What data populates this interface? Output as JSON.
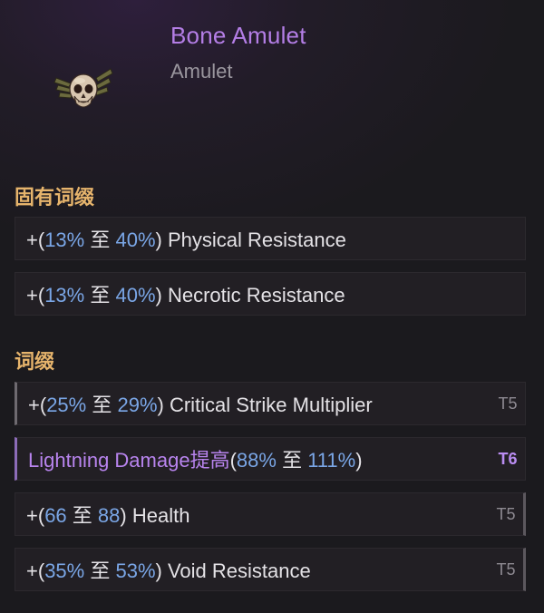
{
  "item": {
    "name": "Bone Amulet",
    "type": "Amulet",
    "icon": "skull-amulet-icon",
    "name_color": "#b47ee6"
  },
  "implicit_section": {
    "title": "固有词缀",
    "rows": [
      {
        "prefix": "+(",
        "min": "13%",
        "sep": " 至 ",
        "max": "40%",
        "suffix": ") Physical Resistance"
      },
      {
        "prefix": "+(",
        "min": "13%",
        "sep": " 至 ",
        "max": "40%",
        "suffix": ") Necrotic Resistance"
      }
    ]
  },
  "affix_section": {
    "title": "词缀",
    "rows": [
      {
        "prefix": "+(",
        "min": "25%",
        "sep": " 至 ",
        "max": "29%",
        "suffix": ") Critical Strike Multiplier",
        "tier": "T5"
      },
      {
        "lead": "Lightning Damage提高",
        "prefix": "(",
        "min": "88%",
        "sep": " 至 ",
        "max": "111%",
        "suffix": ")",
        "tier": "T6"
      },
      {
        "prefix": "+(",
        "min": "66",
        "sep": " 至 ",
        "max": "88",
        "suffix": ") Health",
        "tier": "T5"
      },
      {
        "prefix": "+(",
        "min": "35%",
        "sep": " 至 ",
        "max": "53%",
        "suffix": ") Void Resistance",
        "tier": "T5"
      }
    ]
  }
}
